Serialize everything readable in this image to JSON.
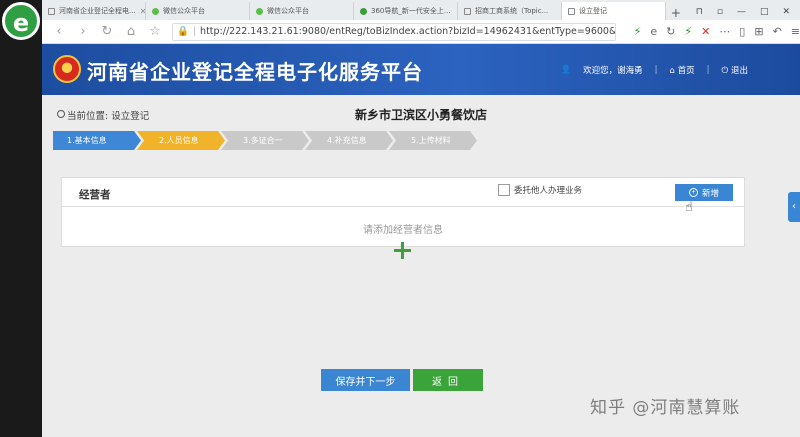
{
  "browser": {
    "logo": "e",
    "tabs": [
      {
        "label": "河南省企业登记全程电...",
        "icon": "page-icon",
        "active": false
      },
      {
        "label": "微信公众平台",
        "icon": "wechat-icon",
        "active": false
      },
      {
        "label": "微信公众平台",
        "icon": "wechat-icon",
        "active": false
      },
      {
        "label": "360导航_新一代安全上...",
        "icon": "360-icon",
        "active": false
      },
      {
        "label": "招商工商系统（Topic...",
        "icon": "page-icon",
        "active": false
      },
      {
        "label": "设立登记",
        "icon": "page-icon",
        "active": true
      }
    ],
    "new_tab": "+",
    "window_controls": [
      "⊓",
      "▫",
      "—",
      "□",
      "✕"
    ],
    "url": "http://222.143.21.61:9080/entReg/toBizIndex.action?bizId=14962431&entType=9600&bizType=02",
    "toolbar_icons": [
      "⚡",
      "e",
      "↻",
      "⚡",
      "✕",
      "⋯",
      "▯",
      "⊞",
      "↶",
      "≡"
    ]
  },
  "site": {
    "title": "河南省企业登记全程电子化服务平台",
    "user_greeting": "欢迎您，谢海勇",
    "home_label": "首页",
    "logout_label": "退出"
  },
  "content": {
    "location_label": "当前位置: 设立登记",
    "page_title": "新乡市卫滨区小勇餐饮店",
    "steps": [
      {
        "label": "1.基本信息",
        "status": "done"
      },
      {
        "label": "2.人员信息",
        "status": "current"
      },
      {
        "label": "3.多证合一",
        "status": "pending"
      },
      {
        "label": "4.补充信息",
        "status": "pending"
      },
      {
        "label": "5.上传材料",
        "status": "pending"
      }
    ],
    "section_title": "经营者",
    "delegate_label": "委托他人办理业务",
    "add_button_label": "新增",
    "empty_message": "请添加经营者信息",
    "save_next_label": "保存并下一步",
    "back_label": "返回"
  },
  "side_tab_glyph": "‹",
  "watermark": "知乎 @河南慧算账",
  "colors": {
    "header_blue": "#2c63c0",
    "step_done": "#3e86d6",
    "step_current": "#f0b32a",
    "step_pending": "#c9c9c9",
    "save_button": "#3b86d3",
    "back_button": "#3aa33a"
  }
}
